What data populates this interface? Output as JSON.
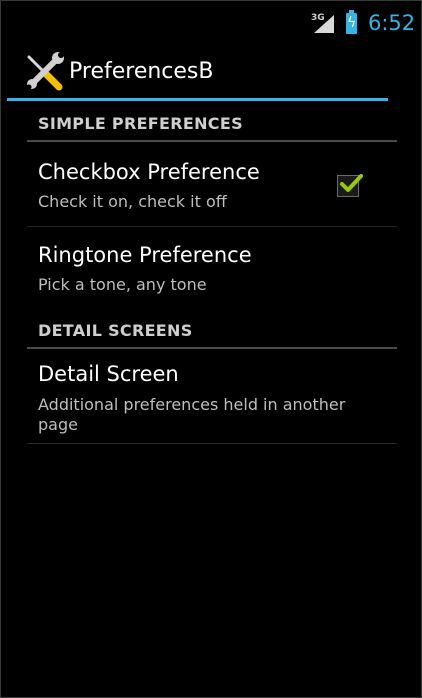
{
  "status_bar": {
    "network_type": "3G",
    "time": "6:52"
  },
  "action_bar": {
    "title": "PreferencesB"
  },
  "categories": [
    {
      "label": "SIMPLE PREFERENCES"
    },
    {
      "label": "DETAIL SCREENS"
    }
  ],
  "preferences": {
    "checkbox": {
      "title": "Checkbox Preference",
      "summary": "Check it on, check it off",
      "checked": true
    },
    "ringtone": {
      "title": "Ringtone Preference",
      "summary": "Pick a tone, any tone"
    },
    "detail": {
      "title": "Detail Screen",
      "summary": "Additional preferences held in another page"
    }
  },
  "colors": {
    "accent": "#33b5e5",
    "background": "#000000",
    "checkmark": "#99cc00"
  }
}
